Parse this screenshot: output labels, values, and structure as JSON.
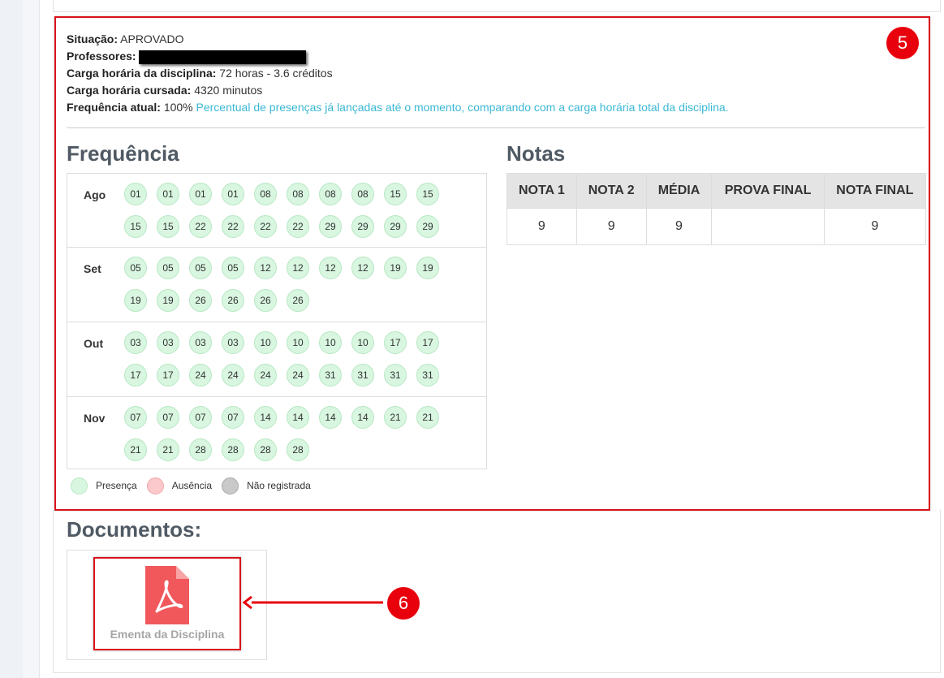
{
  "details": {
    "situacao_label": "Situação:",
    "situacao_value": "APROVADO",
    "professores_label": "Professores:",
    "carga_disciplina_label": "Carga horária da disciplina:",
    "carga_disciplina_value": "72 horas - 3.6 créditos",
    "carga_cursada_label": "Carga horária cursada:",
    "carga_cursada_value": "4320 minutos",
    "frequencia_label": "Frequência atual:",
    "frequencia_value": "100%",
    "frequencia_hint": "Percentual de presenças já lançadas até o momento, comparando com a carga horária total da disciplina."
  },
  "callouts": {
    "step5": "5",
    "step6": "6"
  },
  "frequencia": {
    "title": "Frequência",
    "months": [
      {
        "name": "Ago",
        "days": [
          "01",
          "01",
          "01",
          "01",
          "08",
          "08",
          "08",
          "08",
          "15",
          "15",
          "15",
          "15",
          "22",
          "22",
          "22",
          "22",
          "29",
          "29",
          "29",
          "29"
        ]
      },
      {
        "name": "Set",
        "days": [
          "05",
          "05",
          "05",
          "05",
          "12",
          "12",
          "12",
          "12",
          "19",
          "19",
          "19",
          "19",
          "26",
          "26",
          "26",
          "26"
        ]
      },
      {
        "name": "Out",
        "days": [
          "03",
          "03",
          "03",
          "03",
          "10",
          "10",
          "10",
          "10",
          "17",
          "17",
          "17",
          "17",
          "24",
          "24",
          "24",
          "24",
          "31",
          "31",
          "31",
          "31"
        ]
      },
      {
        "name": "Nov",
        "days": [
          "07",
          "07",
          "07",
          "07",
          "14",
          "14",
          "14",
          "14",
          "21",
          "21",
          "21",
          "21",
          "28",
          "28",
          "28",
          "28"
        ]
      }
    ],
    "legend": [
      {
        "label": "Presença",
        "color": "#d8f6e0",
        "border": "#b7e8c4"
      },
      {
        "label": "Ausência",
        "color": "#fbc9cb",
        "border": "#f3a7ab"
      },
      {
        "label": "Não registrada",
        "color": "#c9c9c9",
        "border": "#aaaaaa"
      }
    ]
  },
  "notas": {
    "title": "Notas",
    "headers": [
      "NOTA 1",
      "NOTA 2",
      "MÉDIA",
      "PROVA FINAL",
      "NOTA FINAL"
    ],
    "values": [
      "9",
      "9",
      "9",
      "",
      "9"
    ]
  },
  "documentos": {
    "title": "Documentos:",
    "items": [
      {
        "label": "Ementa da Disciplina",
        "icon": "pdf-icon"
      }
    ]
  },
  "colors": {
    "highlight": "#d9141b",
    "badge": "#e8000d",
    "pdf": "#f0585c",
    "hint": "#3bb8d4"
  }
}
